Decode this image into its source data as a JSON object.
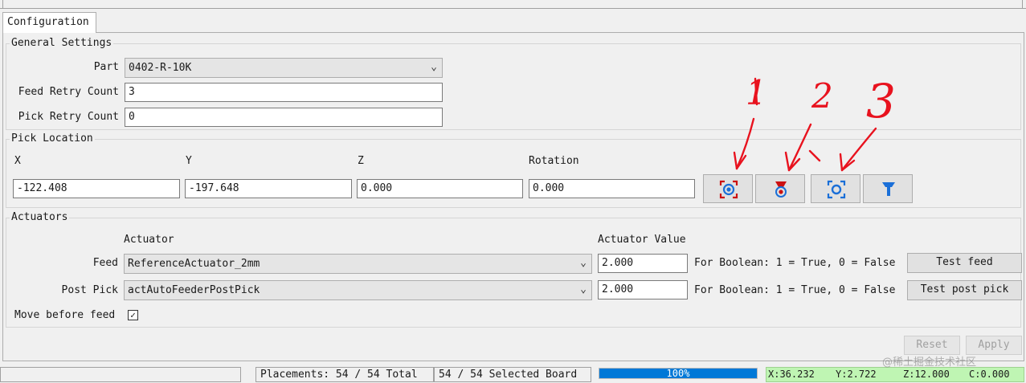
{
  "tab": {
    "label": "Configuration"
  },
  "general": {
    "legend": "General Settings",
    "part_label": "Part",
    "part_value": "0402-R-10K",
    "feed_retry_label": "Feed Retry Count",
    "feed_retry_value": "3",
    "pick_retry_label": "Pick Retry Count",
    "pick_retry_value": "0"
  },
  "pick_location": {
    "legend": "Pick Location",
    "x_label": "X",
    "x_value": "-122.408",
    "y_label": "Y",
    "y_value": "-197.648",
    "z_label": "Z",
    "z_value": "0.000",
    "rotation_label": "Rotation",
    "rotation_value": "0.000",
    "icon_buttons": [
      "capture-camera-location-icon",
      "capture-tool-location-icon",
      "position-camera-icon",
      "position-tool-icon"
    ],
    "icon_color_red": "#cc1111",
    "icon_color_blue": "#1a6fd8",
    "annotation_labels": [
      "1",
      "2",
      "3"
    ],
    "annotation_color": "#e8121e"
  },
  "actuators": {
    "legend": "Actuators",
    "col_actuator": "Actuator",
    "col_value": "Actuator Value",
    "feed_label": "Feed",
    "feed_actuator": "ReferenceActuator_2mm",
    "feed_value": "2.000",
    "feed_hint": "For Boolean: 1 = True, 0 = False",
    "feed_test": "Test feed",
    "post_label": "Post Pick",
    "post_actuator": "actAutoFeederPostPick",
    "post_value": "2.000",
    "post_hint": "For Boolean: 1 = True, 0 = False",
    "post_test": "Test post pick",
    "move_before_label": "Move before feed",
    "move_before_checked": "✓"
  },
  "buttons": {
    "reset": "Reset",
    "apply": "Apply"
  },
  "status": {
    "placements": "Placements: 54 / 54 Total",
    "selected": "54 / 54 Selected Board",
    "progress_text": "100%",
    "progress_fraction": 1.0,
    "x": "X:36.232",
    "y": "Y:2.722",
    "z": "Z:12.000",
    "c": "C:0.000"
  },
  "watermark": "@稀土掘金技术社区"
}
